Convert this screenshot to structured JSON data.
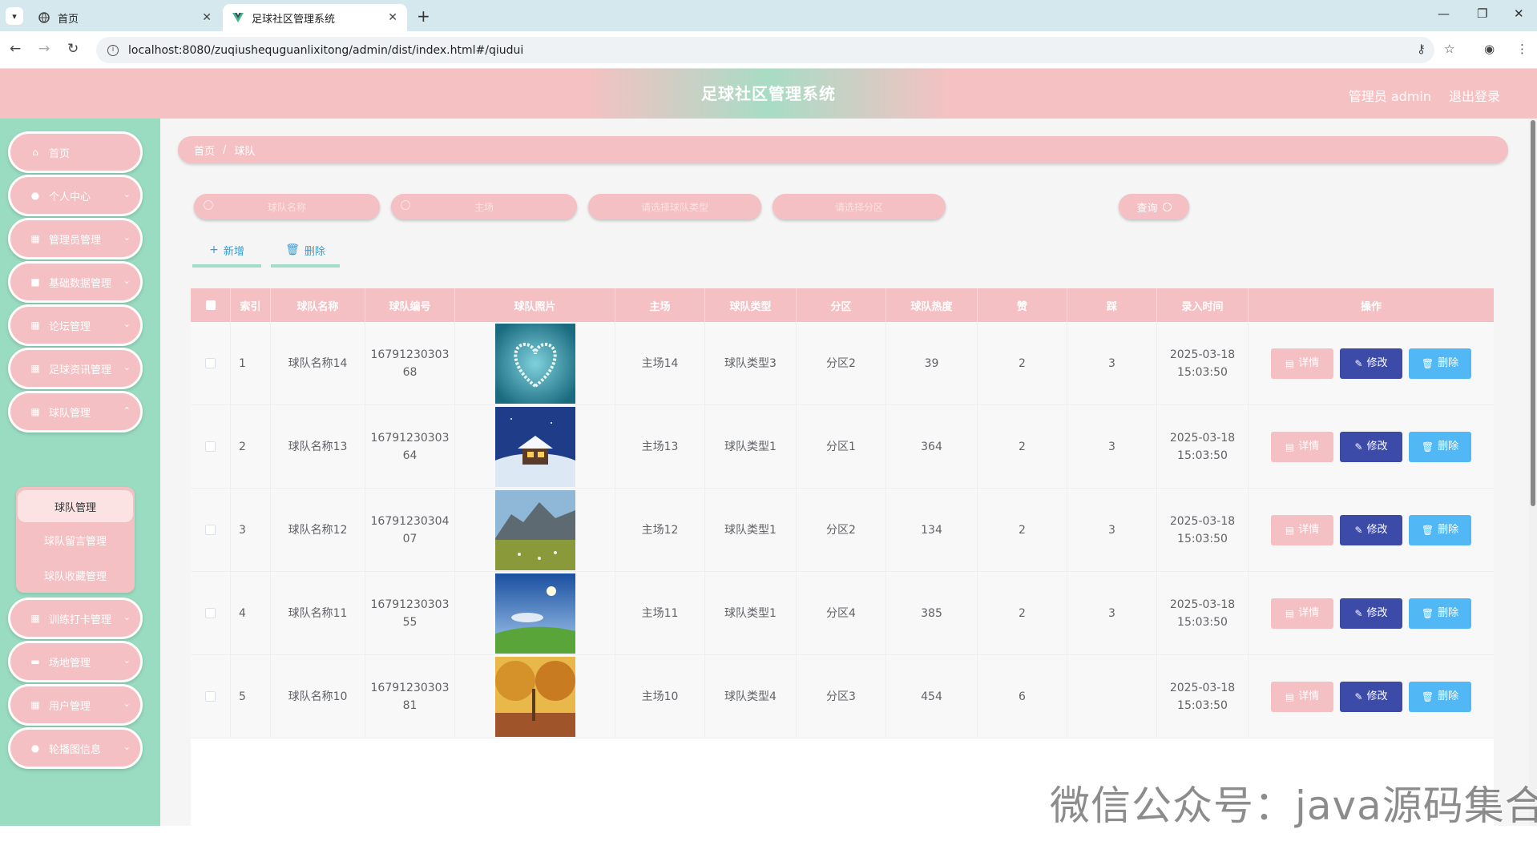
{
  "browser": {
    "tabs": [
      {
        "title": "首页",
        "active": false
      },
      {
        "title": "足球社区管理系统",
        "active": true
      }
    ],
    "url": "localhost:8080/zuqiushequguanlixitong/admin/dist/index.html#/qiudui"
  },
  "header": {
    "title": "足球社区管理系统",
    "user_label": "管理员 admin",
    "logout_label": "退出登录"
  },
  "sidebar": {
    "items": [
      {
        "label": "首页",
        "icon": "home-icon"
      },
      {
        "label": "个人中心",
        "icon": "user-icon"
      },
      {
        "label": "管理员管理",
        "icon": "grid-icon"
      },
      {
        "label": "基础数据管理",
        "icon": "briefcase-icon"
      },
      {
        "label": "论坛管理",
        "icon": "grid-icon"
      },
      {
        "label": "足球资讯管理",
        "icon": "grid-icon"
      },
      {
        "label": "球队管理",
        "icon": "grid-icon"
      },
      {
        "label": "训练打卡管理",
        "icon": "grid-icon"
      },
      {
        "label": "场地管理",
        "icon": "monitor-icon"
      },
      {
        "label": "用户管理",
        "icon": "grid-icon"
      },
      {
        "label": "轮播图信息",
        "icon": "location-icon"
      }
    ],
    "submenu": [
      {
        "label": "球队管理",
        "active": true
      },
      {
        "label": "球队留言管理",
        "active": false
      },
      {
        "label": "球队收藏管理",
        "active": false
      }
    ]
  },
  "breadcrumb": {
    "home": "首页",
    "separator": "/",
    "current": "球队"
  },
  "search": {
    "team_name_placeholder": "球队名称",
    "home_placeholder": "主场",
    "type_placeholder": "请选择球队类型",
    "zone_placeholder": "请选择分区",
    "query_label": "查询"
  },
  "actions": {
    "add_label": "新增",
    "delete_label": "删除"
  },
  "table": {
    "headers": [
      "索引",
      "球队名称",
      "球队编号",
      "球队照片",
      "主场",
      "球队类型",
      "分区",
      "球队热度",
      "赞",
      "踩",
      "录入时间",
      "操作"
    ],
    "rows": [
      {
        "index": "1",
        "name": "球队名称14",
        "code": "1679123030368",
        "photo": "heart-island",
        "home": "主场14",
        "type": "球队类型3",
        "zone": "分区2",
        "heat": "39",
        "like": "2",
        "dislike": "3",
        "time": "2025-03-18 15:03:50"
      },
      {
        "index": "2",
        "name": "球队名称13",
        "code": "1679123030364",
        "photo": "snow-cabin",
        "home": "主场13",
        "type": "球队类型1",
        "zone": "分区1",
        "heat": "364",
        "like": "2",
        "dislike": "3",
        "time": "2025-03-18 15:03:50"
      },
      {
        "index": "3",
        "name": "球队名称12",
        "code": "1679123030407",
        "photo": "mountain-meadow",
        "home": "主场12",
        "type": "球队类型1",
        "zone": "分区2",
        "heat": "134",
        "like": "2",
        "dislike": "3",
        "time": "2025-03-18 15:03:50"
      },
      {
        "index": "4",
        "name": "球队名称11",
        "code": "1679123030355",
        "photo": "sky-grass",
        "home": "主场11",
        "type": "球队类型1",
        "zone": "分区4",
        "heat": "385",
        "like": "2",
        "dislike": "3",
        "time": "2025-03-18 15:03:50"
      },
      {
        "index": "5",
        "name": "球队名称10",
        "code": "1679123030381",
        "photo": "autumn-trees",
        "home": "主场10",
        "type": "球队类型4",
        "zone": "分区3",
        "heat": "454",
        "like": "6",
        "dislike": "",
        "time": "2025-03-18 15:03:50"
      }
    ],
    "op_labels": {
      "detail": "详情",
      "edit": "修改",
      "delete": "删除"
    }
  },
  "watermark": "微信公众号：java源码集合",
  "colors": {
    "pink": "#f5c0c3",
    "mint": "#9adcc1",
    "edit": "#3c4ba8",
    "delete": "#52b8f5"
  }
}
